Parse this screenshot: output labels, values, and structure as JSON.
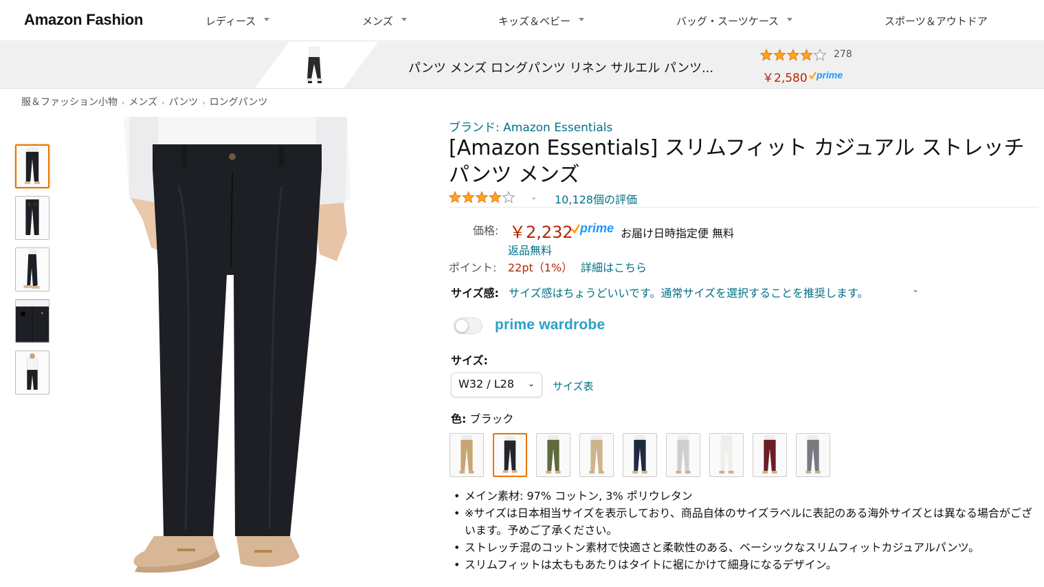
{
  "nav": {
    "logo": "Amazon Fashion",
    "items": [
      "レディース",
      "メンズ",
      "キッズ＆ベビー",
      "バッグ・スーツケース",
      "スポーツ＆アウトドア"
    ]
  },
  "sticky": {
    "title": "パンツ メンズ ロングパンツ リネン サルエル パンツ...",
    "rating_count": "278",
    "rating": 4.0,
    "price": "￥2,580",
    "prime": "prime"
  },
  "breadcrumb": [
    "服＆ファッション小物",
    "メンズ",
    "パンツ",
    "ロングパンツ"
  ],
  "product": {
    "brand": "ブランド: Amazon Essentials",
    "title": "[Amazon Essentials] スリムフィット カジュアル ストレッチ パンツ メンズ",
    "rating": 4.0,
    "ratings_link": "10,128個の評価",
    "price_label": "価格:",
    "price": "￥2,232",
    "prime": "prime",
    "delivery": "お届け日時指定便 無料",
    "returns": "返品無料",
    "points_label": "ポイント:",
    "points": "22pt（1%）",
    "points_link": "詳細はこちら",
    "fit_label": "サイズ感:",
    "fit_text": "サイズ感はちょうどいいです。通常サイズを選択することを推奨します。",
    "prime_wardrobe": "prime wardrobe",
    "size_label": "サイズ:",
    "size_selected": "W32 / L28",
    "size_chart": "サイズ表",
    "color_label": "色:",
    "color_value": "ブラック",
    "swatch_colors": [
      "#c9a574",
      "#23252b",
      "#5f6b3c",
      "#cdb48c",
      "#1e2a44",
      "#cfcfcf",
      "#eeeeea",
      "#6a1e24",
      "#777a80"
    ],
    "bullets": [
      "メイン素材: 97% コットン, 3% ポリウレタン",
      "※サイズは日本相当サイズを表示しており、商品自体のサイズラベルに表記のある海外サイズとは異なる場合がございます。予めご了承ください。",
      "ストレッチ混のコットン素材で快適さと柔軟性のある、ベーシックなスリムフィットカジュアルパンツ。",
      "スリムフィットは太ももあたりはタイトに裾にかけて細身になるデザイン。"
    ]
  },
  "colors": {
    "link": "#007185",
    "price": "#B12704",
    "selected_border": "#e77600",
    "star": "#ffa41c",
    "prime_wardrobe": "#2aa1c4"
  }
}
